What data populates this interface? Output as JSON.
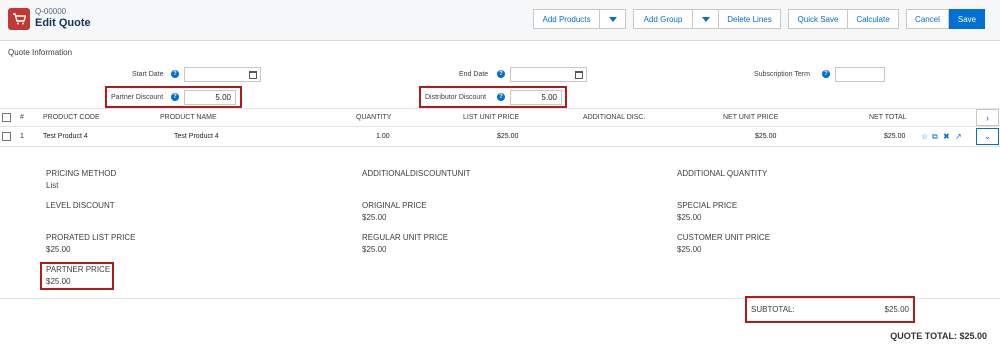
{
  "header": {
    "quote_number": "Q-00000",
    "title": "Edit Quote"
  },
  "toolbar": {
    "add_products": "Add Products",
    "add_group": "Add Group",
    "delete_lines": "Delete Lines",
    "quick_save": "Quick Save",
    "calculate": "Calculate",
    "cancel": "Cancel",
    "save": "Save"
  },
  "quote_info": {
    "section_title": "Quote Information",
    "start_date_label": "Start Date",
    "end_date_label": "End Date",
    "subscription_term_label": "Subscription Term",
    "start_date": "",
    "end_date": "",
    "subscription_term": "",
    "partner_discount_label": "Partner Discount",
    "partner_discount": "5.00",
    "distributor_discount_label": "Distributor Discount",
    "distributor_discount": "5.00"
  },
  "table": {
    "columns": [
      "#",
      "PRODUCT CODE",
      "PRODUCT NAME",
      "QUANTITY",
      "LIST UNIT PRICE",
      "ADDITIONAL DISC.",
      "NET UNIT PRICE",
      "NET TOTAL"
    ],
    "rows": [
      {
        "num": "1",
        "product_code": "Test Product 4",
        "product_name": "Test Product 4",
        "quantity": "1.00",
        "list_unit_price": "$25.00",
        "additional_disc": "",
        "net_unit_price": "$25.00",
        "net_total": "$25.00"
      }
    ]
  },
  "details": {
    "pricing_method_label": "PRICING METHOD",
    "pricing_method": "List",
    "additional_discount_unit_label": "ADDITIONALDISCOUNTUNIT",
    "additional_quantity_label": "ADDITIONAL QUANTITY",
    "level_discount_label": "LEVEL DISCOUNT",
    "original_price_label": "ORIGINAL PRICE",
    "original_price": "$25.00",
    "special_price_label": "SPECIAL PRICE",
    "special_price": "$25.00",
    "prorated_list_price_label": "PRORATED LIST PRICE",
    "prorated_list_price": "$25.00",
    "regular_unit_price_label": "REGULAR UNIT PRICE",
    "regular_unit_price": "$25.00",
    "customer_unit_price_label": "CUSTOMER UNIT PRICE",
    "customer_unit_price": "$25.00",
    "partner_price_label": "PARTNER PRICE",
    "partner_price": "$25.00"
  },
  "totals": {
    "subtotal_label": "SUBTOTAL:",
    "subtotal": "$25.00",
    "quote_total": "QUOTE TOTAL: $25.00"
  },
  "icons": [
    "cart-icon",
    "help-icon",
    "calendar-icon",
    "caret-down-icon",
    "chevron-right-icon",
    "chevron-down-icon",
    "star-icon",
    "clone-icon",
    "delete-icon",
    "trend-icon"
  ],
  "colors": {
    "accent": "#0070d2",
    "highlight": "#b01b1b",
    "app_icon": "#c23934"
  }
}
